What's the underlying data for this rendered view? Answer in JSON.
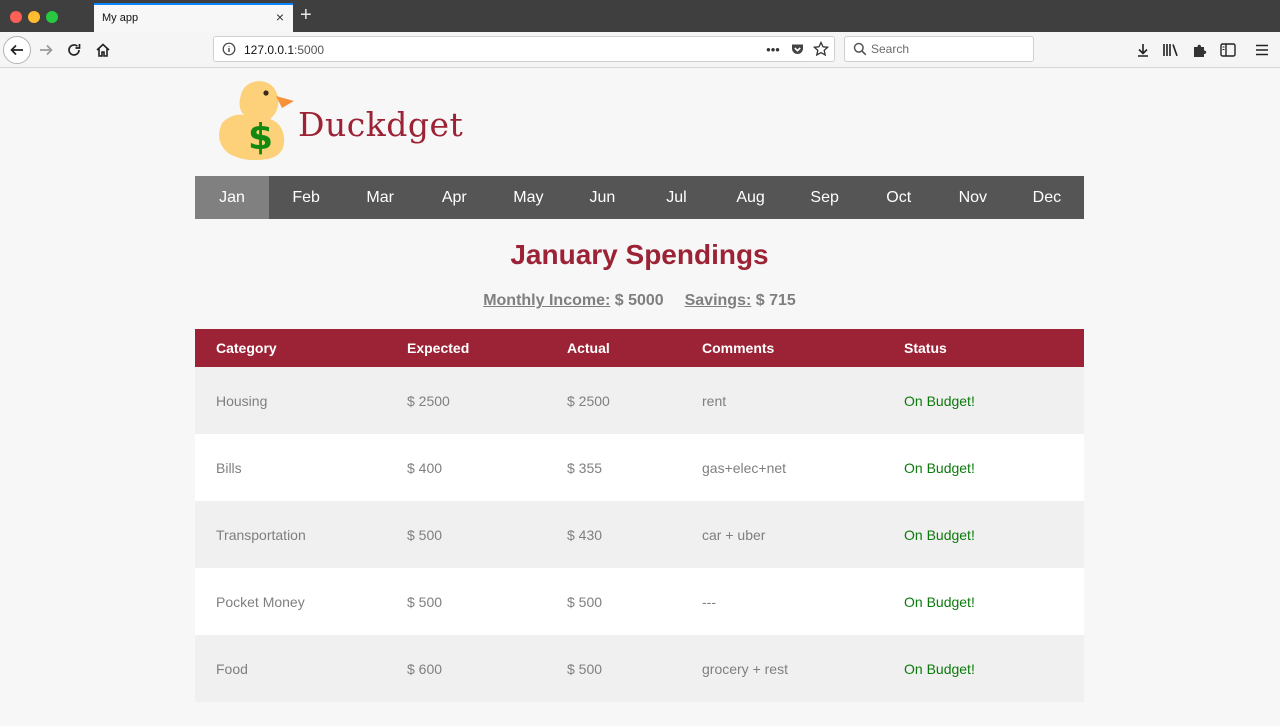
{
  "browser": {
    "tab_title": "My app",
    "tab_close": "×",
    "new_tab": "+",
    "url_host": "127.0.0.1",
    "url_port": ":5000",
    "url_more": "•••",
    "search_placeholder": "Search"
  },
  "app": {
    "brand": "Duckdget",
    "logo_symbol": "$",
    "colors": {
      "brand": "#9b2335",
      "nav": "#555555",
      "nav_active": "#808080",
      "status_ok": "#0c7a0c"
    }
  },
  "months": [
    "Jan",
    "Feb",
    "Mar",
    "Apr",
    "May",
    "Jun",
    "Jul",
    "Aug",
    "Sep",
    "Oct",
    "Nov",
    "Dec"
  ],
  "active_month": "Jan",
  "page": {
    "heading": "January Spendings",
    "income_label": "Monthly Income:",
    "income_value": "$ 5000",
    "savings_label": "Savings:",
    "savings_value": "$ 715"
  },
  "table": {
    "columns": [
      "Category",
      "Expected",
      "Actual",
      "Comments",
      "Status"
    ],
    "rows": [
      {
        "category": "Housing",
        "expected": "$ 2500",
        "actual": "$ 2500",
        "comments": "rent",
        "status": "On Budget!"
      },
      {
        "category": "Bills",
        "expected": "$ 400",
        "actual": "$ 355",
        "comments": "gas+elec+net",
        "status": "On Budget!"
      },
      {
        "category": "Transportation",
        "expected": "$ 500",
        "actual": "$ 430",
        "comments": "car + uber",
        "status": "On Budget!"
      },
      {
        "category": "Pocket Money",
        "expected": "$ 500",
        "actual": "$ 500",
        "comments": "---",
        "status": "On Budget!"
      },
      {
        "category": "Food",
        "expected": "$ 600",
        "actual": "$ 500",
        "comments": "grocery + rest",
        "status": "On Budget!"
      }
    ]
  }
}
